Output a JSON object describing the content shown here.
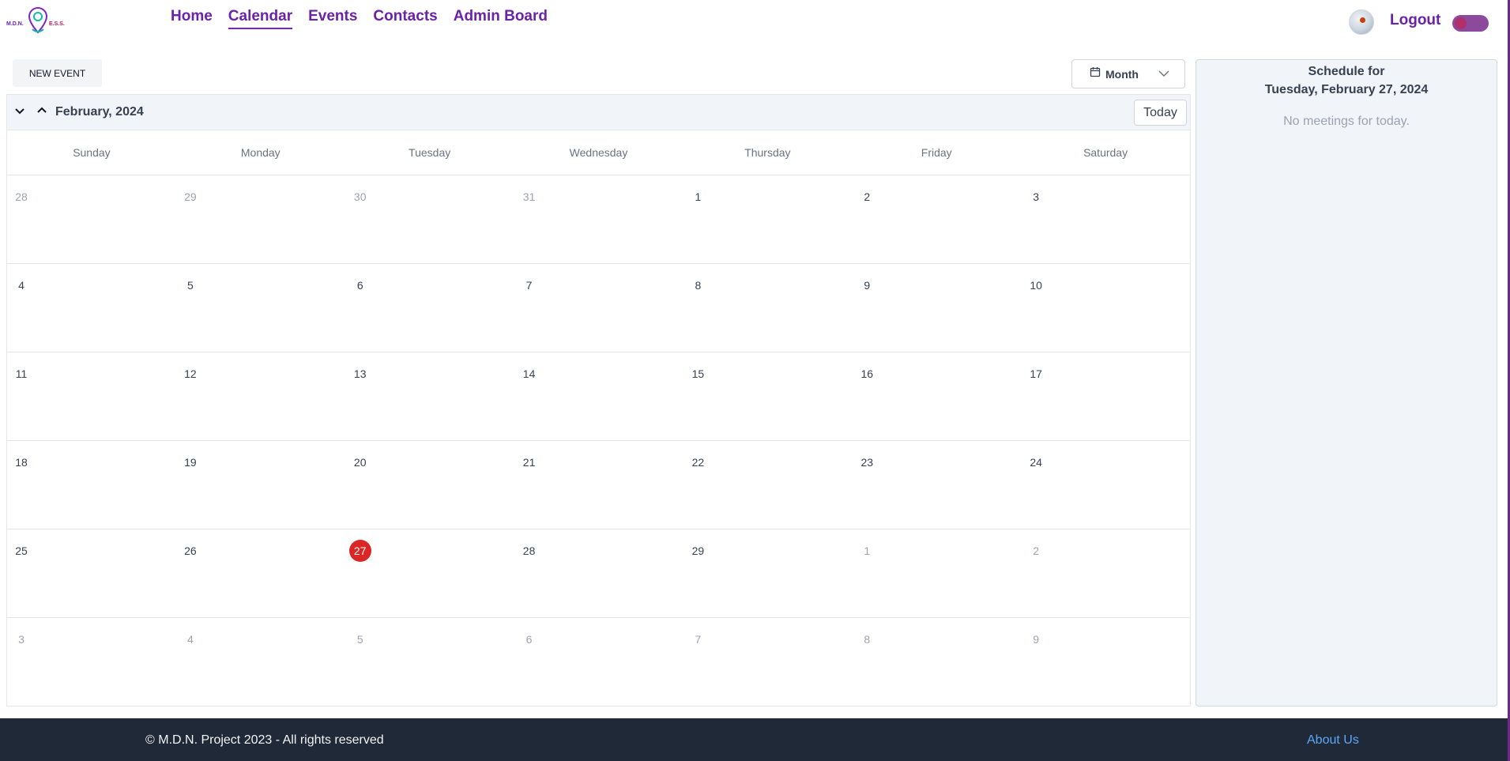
{
  "nav": {
    "logo_text_left": "M.D.N.",
    "logo_text_right": "E.S.S.",
    "links": [
      {
        "label": "Home",
        "active": false
      },
      {
        "label": "Calendar",
        "active": true
      },
      {
        "label": "Events",
        "active": false
      },
      {
        "label": "Contacts",
        "active": false
      },
      {
        "label": "Admin Board",
        "active": false
      }
    ],
    "logout_label": "Logout"
  },
  "toolbar": {
    "new_event_label": "NEW EVENT",
    "view_label": "Month"
  },
  "calendar": {
    "month_label": "February, 2024",
    "today_label": "Today",
    "weekdays": [
      "Sunday",
      "Monday",
      "Tuesday",
      "Wednesday",
      "Thursday",
      "Friday",
      "Saturday"
    ],
    "weeks": [
      [
        {
          "d": "28",
          "out": true
        },
        {
          "d": "29",
          "out": true
        },
        {
          "d": "30",
          "out": true
        },
        {
          "d": "31",
          "out": true
        },
        {
          "d": "1"
        },
        {
          "d": "2"
        },
        {
          "d": "3"
        }
      ],
      [
        {
          "d": "4"
        },
        {
          "d": "5"
        },
        {
          "d": "6"
        },
        {
          "d": "7"
        },
        {
          "d": "8"
        },
        {
          "d": "9"
        },
        {
          "d": "10"
        }
      ],
      [
        {
          "d": "11"
        },
        {
          "d": "12"
        },
        {
          "d": "13"
        },
        {
          "d": "14"
        },
        {
          "d": "15"
        },
        {
          "d": "16"
        },
        {
          "d": "17"
        }
      ],
      [
        {
          "d": "18"
        },
        {
          "d": "19"
        },
        {
          "d": "20"
        },
        {
          "d": "21"
        },
        {
          "d": "22"
        },
        {
          "d": "23"
        },
        {
          "d": "24"
        }
      ],
      [
        {
          "d": "25"
        },
        {
          "d": "26"
        },
        {
          "d": "27",
          "today": true
        },
        {
          "d": "28"
        },
        {
          "d": "29"
        },
        {
          "d": "1",
          "out": true
        },
        {
          "d": "2",
          "out": true
        }
      ],
      [
        {
          "d": "3",
          "out": true
        },
        {
          "d": "4",
          "out": true
        },
        {
          "d": "5",
          "out": true
        },
        {
          "d": "6",
          "out": true
        },
        {
          "d": "7",
          "out": true
        },
        {
          "d": "8",
          "out": true
        },
        {
          "d": "9",
          "out": true
        }
      ]
    ],
    "today_color": "#dc2626"
  },
  "schedule": {
    "title": "Schedule for",
    "date": "Tuesday, February 27, 2024",
    "empty_text": "No meetings for today."
  },
  "footer": {
    "copyright": "© M.D.N. Project 2023 - All rights reserved",
    "about_label": "About Us"
  },
  "colors": {
    "brand_purple": "#6b21a8",
    "footer_bg": "#1f2937",
    "link_blue": "#60a5fa"
  }
}
